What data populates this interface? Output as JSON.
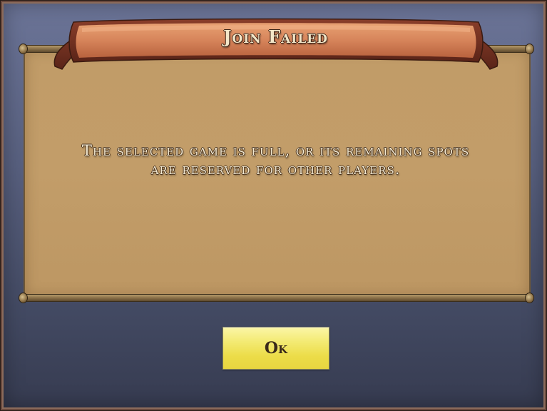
{
  "dialog": {
    "title": "Join Failed",
    "message_line1": "The selected game is full, or its remaining spots",
    "message_line2": "are reserved for other players.",
    "ok_label": "Ok"
  },
  "colors": {
    "background_top": "#6b7497",
    "background_bottom": "#363b50",
    "parchment": "#c19c68",
    "banner": "#d9875a",
    "button": "#f3ea72",
    "text": "#f4ead2"
  }
}
